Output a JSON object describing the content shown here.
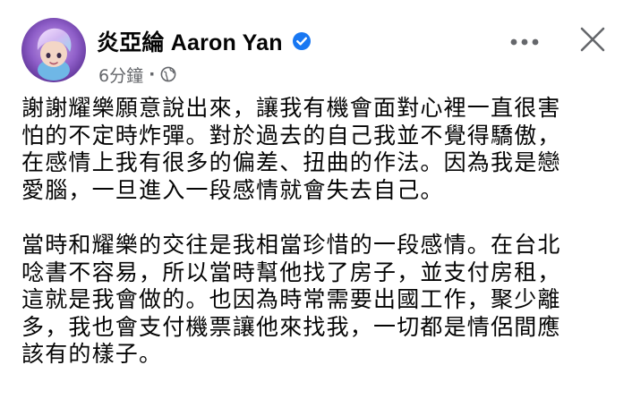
{
  "post": {
    "author": "炎亞綸 Aaron Yan",
    "timestamp": "6分鐘",
    "separator": "·",
    "privacy_icon": "globe-icon",
    "verified_icon": "verified-badge-icon",
    "more_icon": "more-horizontal-icon",
    "close_icon": "close-icon",
    "paragraphs": [
      "謝謝耀樂願意說出來，讓我有機會面對心裡一直很害\n怕的不定時炸彈。對於過去的自己我並不覺得驕傲，\n在感情上我有很多的偏差、扭曲的作法。因為我是戀\n愛腦，一旦進入一段感情就會失去自己。",
      "當時和耀樂的交往是我相當珍惜的一段感情。在台北\n唸書不容易，所以當時幫他找了房子，並支付房租，\n這就是我會做的。也因為時常需要出國工作，聚少離\n多，我也會支付機票讓他來找我，一切都是情侶間應\n該有的樣子。"
    ]
  },
  "colors": {
    "text": "#050505",
    "secondary": "#65676b",
    "verified": "#1877f2"
  }
}
